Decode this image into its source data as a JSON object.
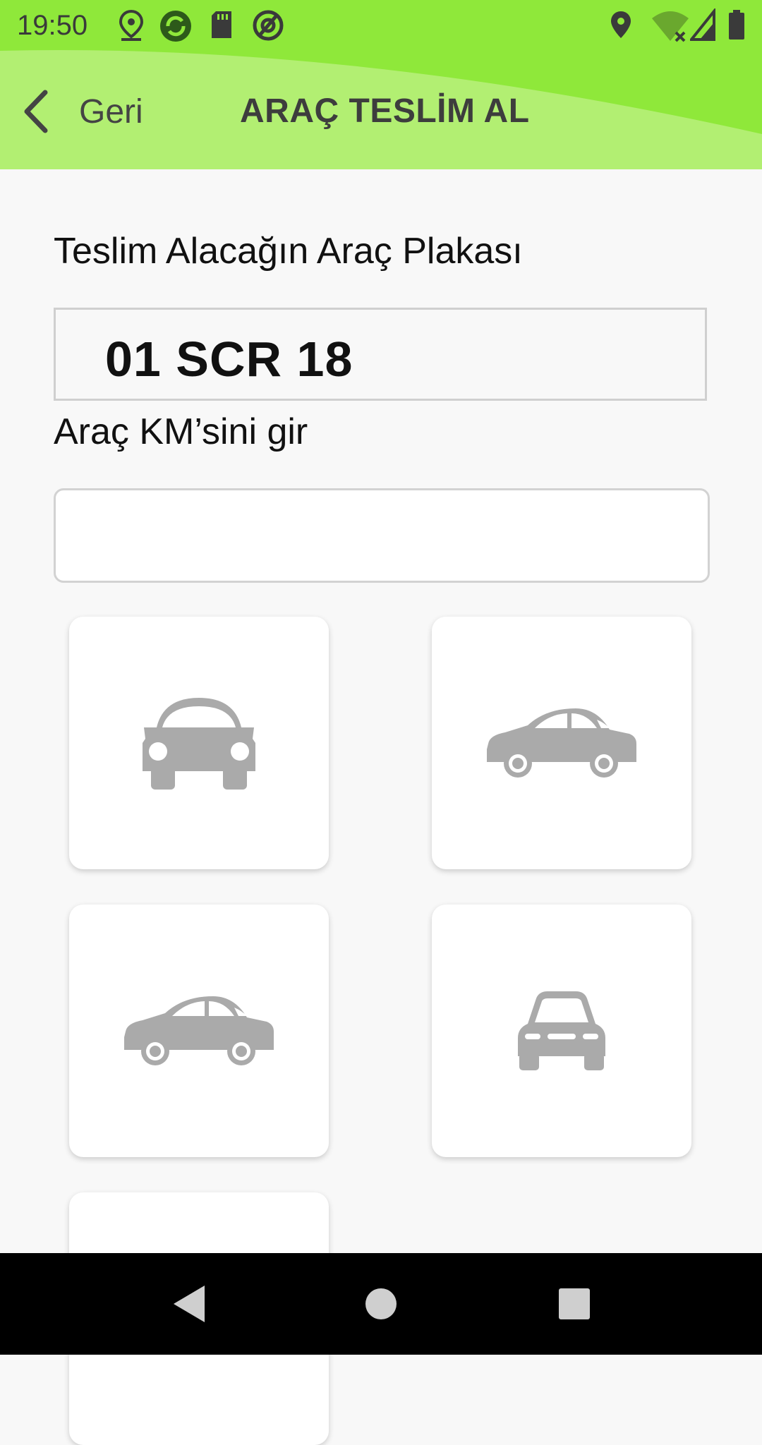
{
  "status_bar": {
    "time": "19:50",
    "left_icons": [
      "location-pin-icon",
      "sync-app-icon",
      "sd-card-icon",
      "at-sign-icon"
    ],
    "right_icons": [
      "location-pin-icon",
      "wifi-off-icon",
      "signal-icon",
      "battery-icon"
    ]
  },
  "app_bar": {
    "back_label": "Geri",
    "title": "ARAÇ TESLİM AL",
    "background_color": "#8fe83a"
  },
  "form": {
    "plate_label": "Teslim Alacağın Araç Plakası",
    "plate_value": "01 SCR 18",
    "km_label": "Araç KM’sini gir",
    "km_value": "",
    "km_placeholder": ""
  },
  "photo_cards": [
    {
      "icon": "car-front-icon"
    },
    {
      "icon": "car-right-side-icon"
    },
    {
      "icon": "car-left-side-icon"
    },
    {
      "icon": "car-rear-icon"
    },
    {
      "icon": "empty-card"
    }
  ],
  "nav_bar": {
    "buttons": [
      "back-icon",
      "home-icon",
      "recents-icon"
    ]
  },
  "colors": {
    "accent": "#8fe83a",
    "icon_gray": "#aaaaaa",
    "text": "#111111"
  }
}
